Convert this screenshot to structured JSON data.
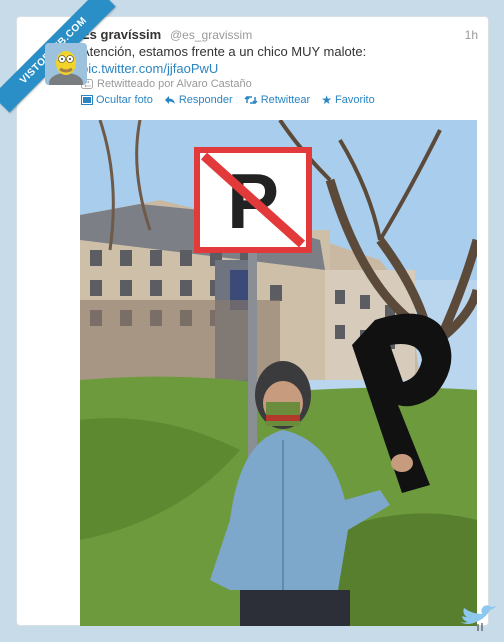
{
  "banner": {
    "text": "VISTOENFB.COM"
  },
  "tweet": {
    "name": "És gravíssim",
    "handle": "@es_gravissim",
    "time": "1h",
    "text": "Atención, estamos frente a un chico MUY malote:",
    "link": "pic.twitter.com/jjfaoPwU",
    "retweeted_by": "Retwitteado por Alvaro Castaño"
  },
  "actions": {
    "hide_photo": "Ocultar foto",
    "reply": "Responder",
    "retweet": "Retwittear",
    "favorite": "Favorito"
  },
  "colors": {
    "link": "#2a85c2",
    "background": "#c7dbe9",
    "banner": "#2b8fc7"
  },
  "icons": [
    "photo-icon",
    "reply-icon",
    "retweet-icon",
    "star-icon",
    "twitter-bird-icon"
  ]
}
